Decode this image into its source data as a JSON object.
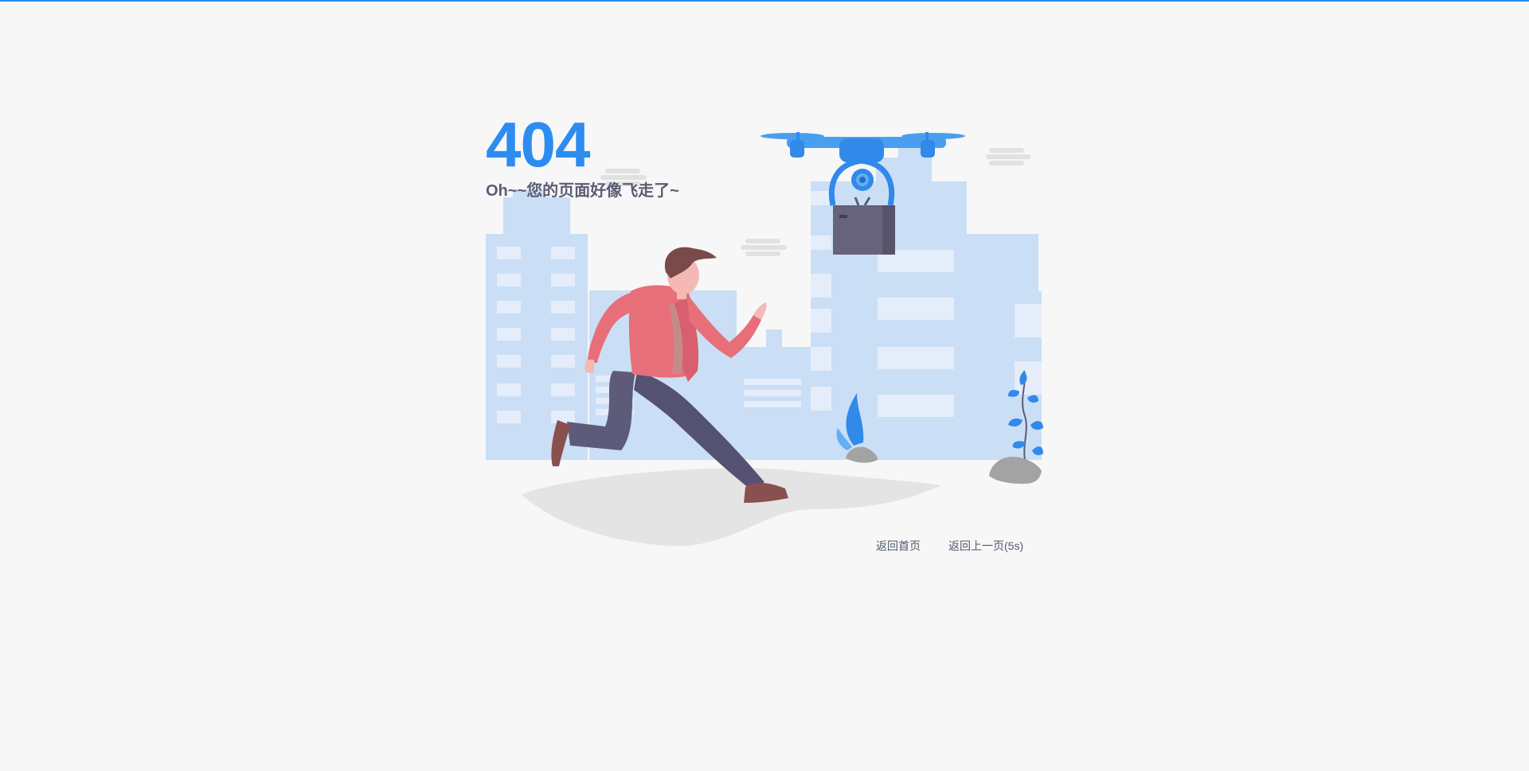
{
  "error": {
    "code": "404",
    "message": "Oh~~您的页面好像飞走了~"
  },
  "actions": {
    "home_label": "返回首页",
    "back_label": "返回上一页(5s)"
  },
  "colors": {
    "accent": "#2d8cf0",
    "page_background": "#f7f7f7",
    "buildings": "#cadff6",
    "text_muted": "#5b5d75"
  },
  "illustration": {
    "description_icons": [
      "drone-icon",
      "running-man-icon",
      "package-icon",
      "plant-icon",
      "flame-plant-icon",
      "cloud-icon"
    ]
  }
}
